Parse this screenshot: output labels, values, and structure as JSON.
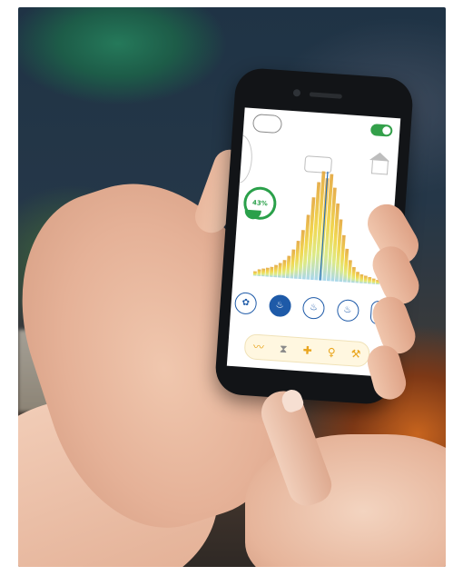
{
  "scene": {
    "description_label": "",
    "app": {
      "humidity_value": "43%",
      "mode_buttons": [
        {
          "icon": "leaf-icon",
          "glyph": "✿"
        },
        {
          "icon": "flame-icon",
          "glyph": "♨",
          "active": true
        },
        {
          "icon": "flame-outline-icon",
          "glyph": "♨"
        },
        {
          "icon": "flame-outline-2-icon",
          "glyph": "♨"
        },
        {
          "icon": "toggle-pill-icon",
          "glyph": "●"
        }
      ],
      "bottom_icons": [
        {
          "icon": "wave-icon",
          "glyph": "〰"
        },
        {
          "icon": "hourglass-icon",
          "glyph": "⧗"
        },
        {
          "icon": "sun-icon",
          "glyph": "✚"
        },
        {
          "icon": "bulb-icon",
          "glyph": "♀"
        },
        {
          "icon": "wrench-icon",
          "glyph": "⚒"
        }
      ],
      "chart_bars": [
        4,
        6,
        7,
        8,
        9,
        11,
        13,
        16,
        20,
        26,
        34,
        44,
        58,
        74,
        88,
        98,
        92,
        96,
        84,
        70,
        56,
        42,
        30,
        20,
        14,
        10,
        8,
        7,
        6,
        5,
        4
      ]
    }
  },
  "colors": {
    "accent_green": "#2aa04a",
    "accent_blue": "#1e5aa8",
    "accent_yellow": "#e9a51d"
  }
}
